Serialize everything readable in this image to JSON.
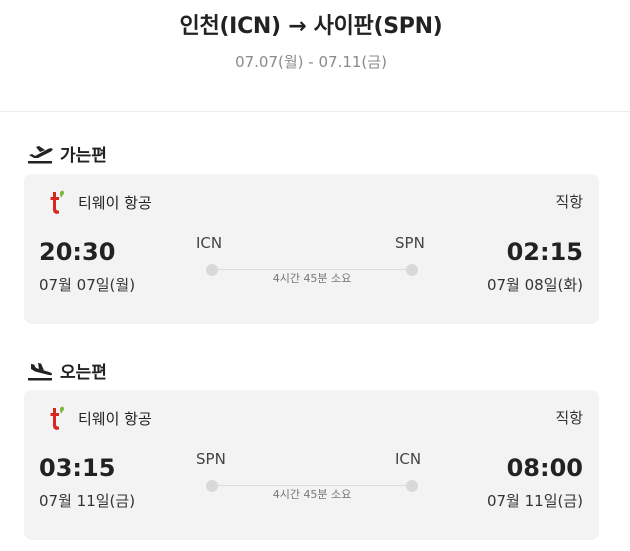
{
  "header": {
    "route_title": "인천(ICN) → 사이판(SPN)",
    "dates": "07.07(월) - 07.11(금)"
  },
  "outbound": {
    "section_title": "가는편",
    "icon": "plane-takeoff-icon",
    "airline_logo_icon": "tway-logo-icon",
    "airline": "티웨이 항공",
    "flight_type": "직항",
    "departure_time": "20:30",
    "departure_date": "07월 07일(월)",
    "departure_code": "ICN",
    "arrival_time": "02:15",
    "arrival_date": "07월 08일(화)",
    "arrival_code": "SPN",
    "duration": "4시간 45분 소요"
  },
  "inbound": {
    "section_title": "오는편",
    "icon": "plane-landing-icon",
    "airline_logo_icon": "tway-logo-icon",
    "airline": "티웨이 항공",
    "flight_type": "직항",
    "departure_time": "03:15",
    "departure_date": "07월 11일(금)",
    "departure_code": "SPN",
    "arrival_time": "08:00",
    "arrival_date": "07월 11일(금)",
    "arrival_code": "ICN",
    "duration": "4시간 45분 소요"
  },
  "colors": {
    "brand_red": "#d6281f",
    "brand_green": "#7cb342",
    "card_bg": "#f3f3f3",
    "muted_text": "#8a8a8a"
  }
}
